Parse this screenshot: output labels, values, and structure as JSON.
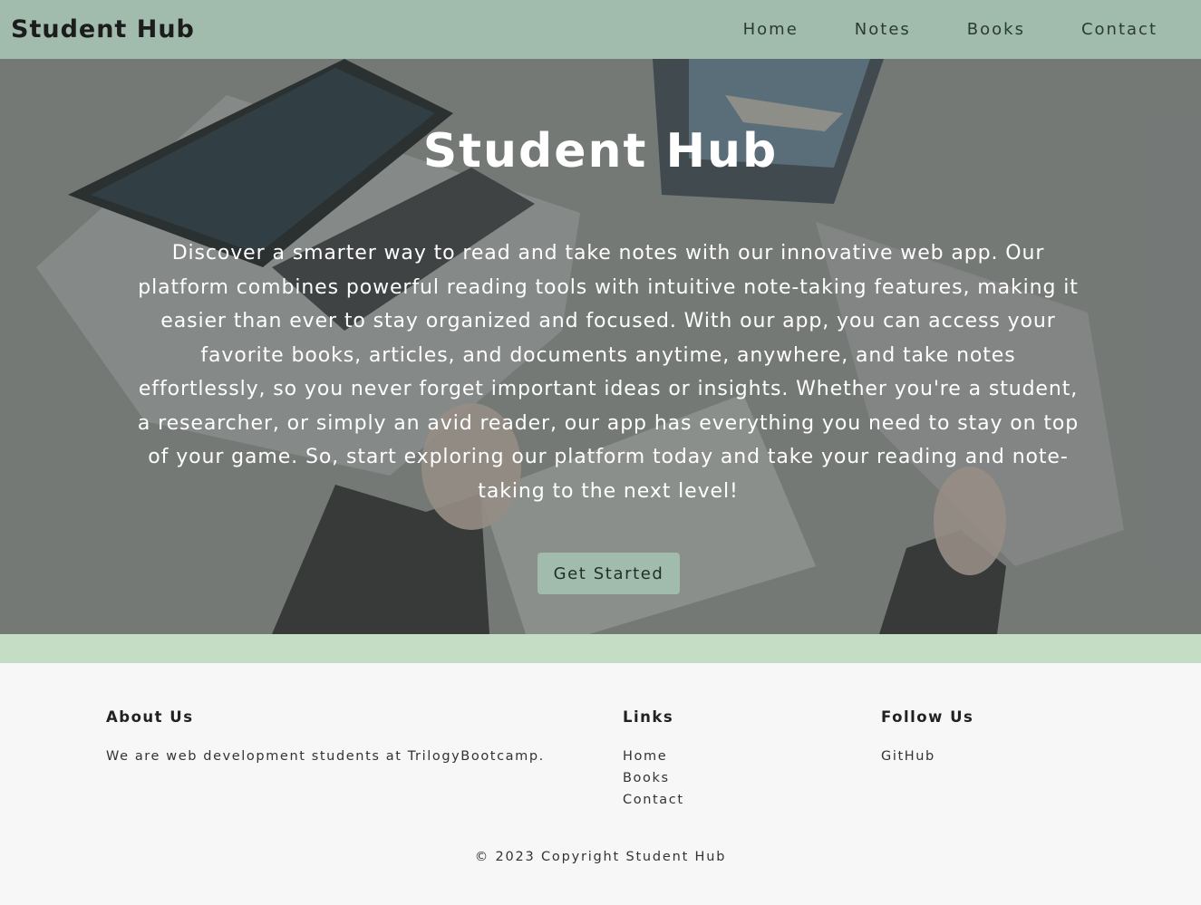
{
  "navbar": {
    "brand": "Student Hub",
    "links": [
      "Home",
      "Notes",
      "Books",
      "Contact"
    ]
  },
  "hero": {
    "title": "Student Hub",
    "description": "Discover a smarter way to read and take notes with our innovative web app. Our platform combines powerful reading tools with intuitive note-taking features, making it easier than ever to stay organized and focused. With our app, you can access your favorite books, articles, and documents anytime, anywhere, and take notes effortlessly, so you never forget important ideas or insights. Whether you're a student, a researcher, or simply an avid reader, our app has everything you need to stay on top of your game. So, start exploring our platform today and take your reading and note-taking to the next level!",
    "cta_label": "Get Started"
  },
  "footer": {
    "about": {
      "heading": "About Us",
      "text": "We are web development students at TrilogyBootcamp."
    },
    "links": {
      "heading": "Links",
      "items": [
        "Home",
        "Books",
        "Contact"
      ]
    },
    "follow": {
      "heading": "Follow Us",
      "items": [
        "GitHub"
      ]
    },
    "copyright": "© 2023 Copyright Student Hub"
  },
  "colors": {
    "nav_bg": "#a1bbac",
    "band": "#c5ddc5",
    "footer_bg": "#f7f7f7",
    "button_bg": "#a1bbac"
  }
}
